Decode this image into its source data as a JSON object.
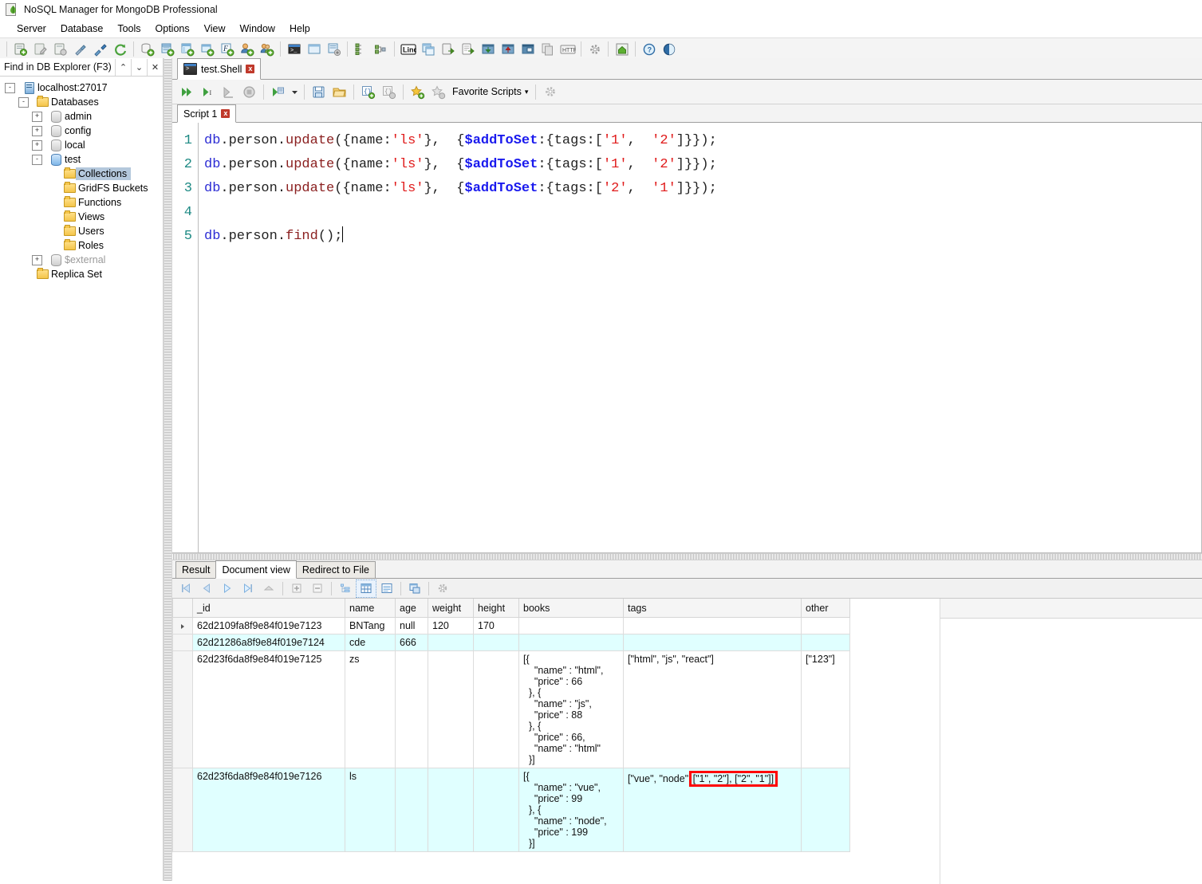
{
  "window": {
    "title": "NoSQL Manager for MongoDB Professional",
    "icon": "app-mongodb-icon"
  },
  "menubar": {
    "items": [
      {
        "label": "Server"
      },
      {
        "label": "Database"
      },
      {
        "label": "Tools"
      },
      {
        "label": "Options"
      },
      {
        "label": "View"
      },
      {
        "label": "Window"
      },
      {
        "label": "Help"
      }
    ]
  },
  "main_toolbar": {
    "groups": [
      [
        "new-connection-icon",
        "edit-connection-icon",
        "copy-connection-icon",
        "connect-icon",
        "disconnect-icon",
        "refresh-icon"
      ],
      [
        "new-database-icon",
        "new-collection-icon",
        "new-view-icon",
        "new-gridfs-icon",
        "new-function-icon",
        "new-user-icon",
        "new-role-icon"
      ],
      [
        "open-shell-icon",
        "open-sql-window-icon",
        "open-query-builder-icon"
      ],
      [
        "db-explorer-icon",
        "schema-explorer-icon"
      ],
      [
        "linq-query-icon",
        "aggregation-icon",
        "import-icon",
        "export-icon",
        "download-icon",
        "upload-icon",
        "execute-script-icon",
        "duplicate-icon",
        "http-icon"
      ],
      [
        "options-gear-icon"
      ],
      [
        "home-icon"
      ],
      [
        "help-icon",
        "about-icon"
      ]
    ]
  },
  "db_explorer": {
    "find_placeholder": "Find in DB Explorer (F3)",
    "find_value": "Find in DB Explorer (F3)",
    "nav": {
      "up": "⌃",
      "down": "⌄",
      "close": "✕"
    },
    "tree": [
      {
        "label": "localhost:27017",
        "depth": 0,
        "expander": "-",
        "icon": "server-icon",
        "selected": false,
        "dim": false
      },
      {
        "label": "Databases",
        "depth": 1,
        "expander": "-",
        "icon": "folder-icon",
        "selected": false,
        "dim": false
      },
      {
        "label": "admin",
        "depth": 2,
        "expander": "+",
        "icon": "database-icon",
        "selected": false,
        "dim": false
      },
      {
        "label": "config",
        "depth": 2,
        "expander": "+",
        "icon": "database-icon",
        "selected": false,
        "dim": false
      },
      {
        "label": "local",
        "depth": 2,
        "expander": "+",
        "icon": "database-icon",
        "selected": false,
        "dim": false
      },
      {
        "label": "test",
        "depth": 2,
        "expander": "-",
        "icon": "database-active-icon",
        "selected": false,
        "dim": false
      },
      {
        "label": "Collections",
        "depth": 3,
        "expander": "",
        "icon": "folder-icon",
        "selected": true,
        "dim": false
      },
      {
        "label": "GridFS Buckets",
        "depth": 3,
        "expander": "",
        "icon": "folder-icon",
        "selected": false,
        "dim": false
      },
      {
        "label": "Functions",
        "depth": 3,
        "expander": "",
        "icon": "folder-icon",
        "selected": false,
        "dim": false
      },
      {
        "label": "Views",
        "depth": 3,
        "expander": "",
        "icon": "folder-icon",
        "selected": false,
        "dim": false
      },
      {
        "label": "Users",
        "depth": 3,
        "expander": "",
        "icon": "folder-icon",
        "selected": false,
        "dim": false
      },
      {
        "label": "Roles",
        "depth": 3,
        "expander": "",
        "icon": "folder-icon",
        "selected": false,
        "dim": false
      },
      {
        "label": "$external",
        "depth": 2,
        "expander": "+",
        "icon": "database-icon",
        "selected": false,
        "dim": true
      },
      {
        "label": "Replica Set",
        "depth": 1,
        "expander": "",
        "icon": "folder-icon",
        "selected": false,
        "dim": false
      }
    ]
  },
  "document_tabs": [
    {
      "label": "test.Shell",
      "icon": "shell-icon",
      "active": true,
      "close": "x"
    }
  ],
  "script_toolbar": {
    "buttons": [
      "execute-all-icon",
      "execute-current-icon",
      "execute-to-cursor-icon",
      "stop-icon",
      "execute-with-options-icon",
      "save-script-icon",
      "open-script-icon",
      "format-json-icon",
      "validate-json-icon",
      "add-favorite-icon",
      "remove-favorite-icon"
    ],
    "favorite_scripts_label": "Favorite Scripts",
    "dropdown_caret": "▾",
    "settings_icon": "gear-icon"
  },
  "script_tabs": [
    {
      "label": "Script 1",
      "active": true,
      "close": "x"
    }
  ],
  "editor": {
    "line_numbers": [
      "1",
      "2",
      "3",
      "4",
      "5"
    ],
    "lines": [
      {
        "tokens": [
          {
            "t": "db",
            "c": "db"
          },
          {
            "t": ".person.",
            "c": "plain"
          },
          {
            "t": "update",
            "c": "fn"
          },
          {
            "t": "({name:",
            "c": "plain"
          },
          {
            "t": "'ls'",
            "c": "str"
          },
          {
            "t": "},  {",
            "c": "plain"
          },
          {
            "t": "$addToSet",
            "c": "op"
          },
          {
            "t": ":{tags:[",
            "c": "plain"
          },
          {
            "t": "'1'",
            "c": "str"
          },
          {
            "t": ",  ",
            "c": "plain"
          },
          {
            "t": "'2'",
            "c": "str"
          },
          {
            "t": "]}});",
            "c": "plain"
          }
        ]
      },
      {
        "tokens": [
          {
            "t": "db",
            "c": "db"
          },
          {
            "t": ".person.",
            "c": "plain"
          },
          {
            "t": "update",
            "c": "fn"
          },
          {
            "t": "({name:",
            "c": "plain"
          },
          {
            "t": "'ls'",
            "c": "str"
          },
          {
            "t": "},  {",
            "c": "plain"
          },
          {
            "t": "$addToSet",
            "c": "op"
          },
          {
            "t": ":{tags:[",
            "c": "plain"
          },
          {
            "t": "'1'",
            "c": "str"
          },
          {
            "t": ",  ",
            "c": "plain"
          },
          {
            "t": "'2'",
            "c": "str"
          },
          {
            "t": "]}});",
            "c": "plain"
          }
        ]
      },
      {
        "tokens": [
          {
            "t": "db",
            "c": "db"
          },
          {
            "t": ".person.",
            "c": "plain"
          },
          {
            "t": "update",
            "c": "fn"
          },
          {
            "t": "({name:",
            "c": "plain"
          },
          {
            "t": "'ls'",
            "c": "str"
          },
          {
            "t": "},  {",
            "c": "plain"
          },
          {
            "t": "$addToSet",
            "c": "op"
          },
          {
            "t": ":{tags:[",
            "c": "plain"
          },
          {
            "t": "'2'",
            "c": "str"
          },
          {
            "t": ",  ",
            "c": "plain"
          },
          {
            "t": "'1'",
            "c": "str"
          },
          {
            "t": "]}});",
            "c": "plain"
          }
        ]
      },
      {
        "tokens": []
      },
      {
        "tokens": [
          {
            "t": "db",
            "c": "db"
          },
          {
            "t": ".person.",
            "c": "plain"
          },
          {
            "t": "find",
            "c": "fn"
          },
          {
            "t": "();",
            "c": "plain"
          }
        ],
        "caret": true
      }
    ]
  },
  "result_tabs": [
    {
      "label": "Result",
      "active": false
    },
    {
      "label": "Document view",
      "active": true
    },
    {
      "label": "Redirect to File",
      "active": false
    }
  ],
  "grid_toolbar": {
    "buttons": [
      "first-record-icon",
      "previous-record-icon",
      "next-record-icon",
      "last-record-icon",
      "collapse-icon",
      "add-record-icon",
      "delete-record-icon",
      "tree-view-icon",
      "table-view-icon",
      "text-view-icon",
      "export-grid-icon",
      "grid-settings-icon"
    ],
    "active_button": "table-view-icon"
  },
  "grid": {
    "columns": [
      "_id",
      "name",
      "age",
      "weight",
      "height",
      "books",
      "tags",
      "other"
    ],
    "rows": [
      {
        "current": true,
        "alt": false,
        "_id": "62d2109fa8f9e84f019e7123",
        "name": "BNTang",
        "age": "null",
        "weight": "120",
        "height": "170",
        "books": "",
        "tags": "",
        "other": ""
      },
      {
        "current": false,
        "alt": true,
        "_id": "62d21286a8f9e84f019e7124",
        "name": "cde",
        "age": "666",
        "weight": "",
        "height": "",
        "books": "",
        "tags": "",
        "other": ""
      },
      {
        "current": false,
        "alt": false,
        "_id": "62d23f6da8f9e84f019e7125",
        "name": "zs",
        "age": "",
        "weight": "",
        "height": "",
        "books": "[{\n    \"name\" : \"html\",\n    \"price\" : 66\n  }, {\n    \"name\" : \"js\",\n    \"price\" : 88\n  }, {\n    \"price\" : 66,\n    \"name\" : \"html\"\n  }]",
        "tags": "[\"html\", \"js\", \"react\"]",
        "other": "[\"123\"]"
      },
      {
        "current": false,
        "alt": true,
        "_id": "62d23f6da8f9e84f019e7126",
        "name": "ls",
        "age": "",
        "weight": "",
        "height": "",
        "books": "[{\n    \"name\" : \"vue\",\n    \"price\" : 99\n  }, {\n    \"name\" : \"node\",\n    \"price\" : 199\n  }]",
        "tags_prefix": "[\"vue\", \"node\",",
        "tags_highlight": "[\"1\", \"2\"], [\"2\", \"1\"]]",
        "other": ""
      }
    ],
    "highlight_color": "#ff0000"
  }
}
